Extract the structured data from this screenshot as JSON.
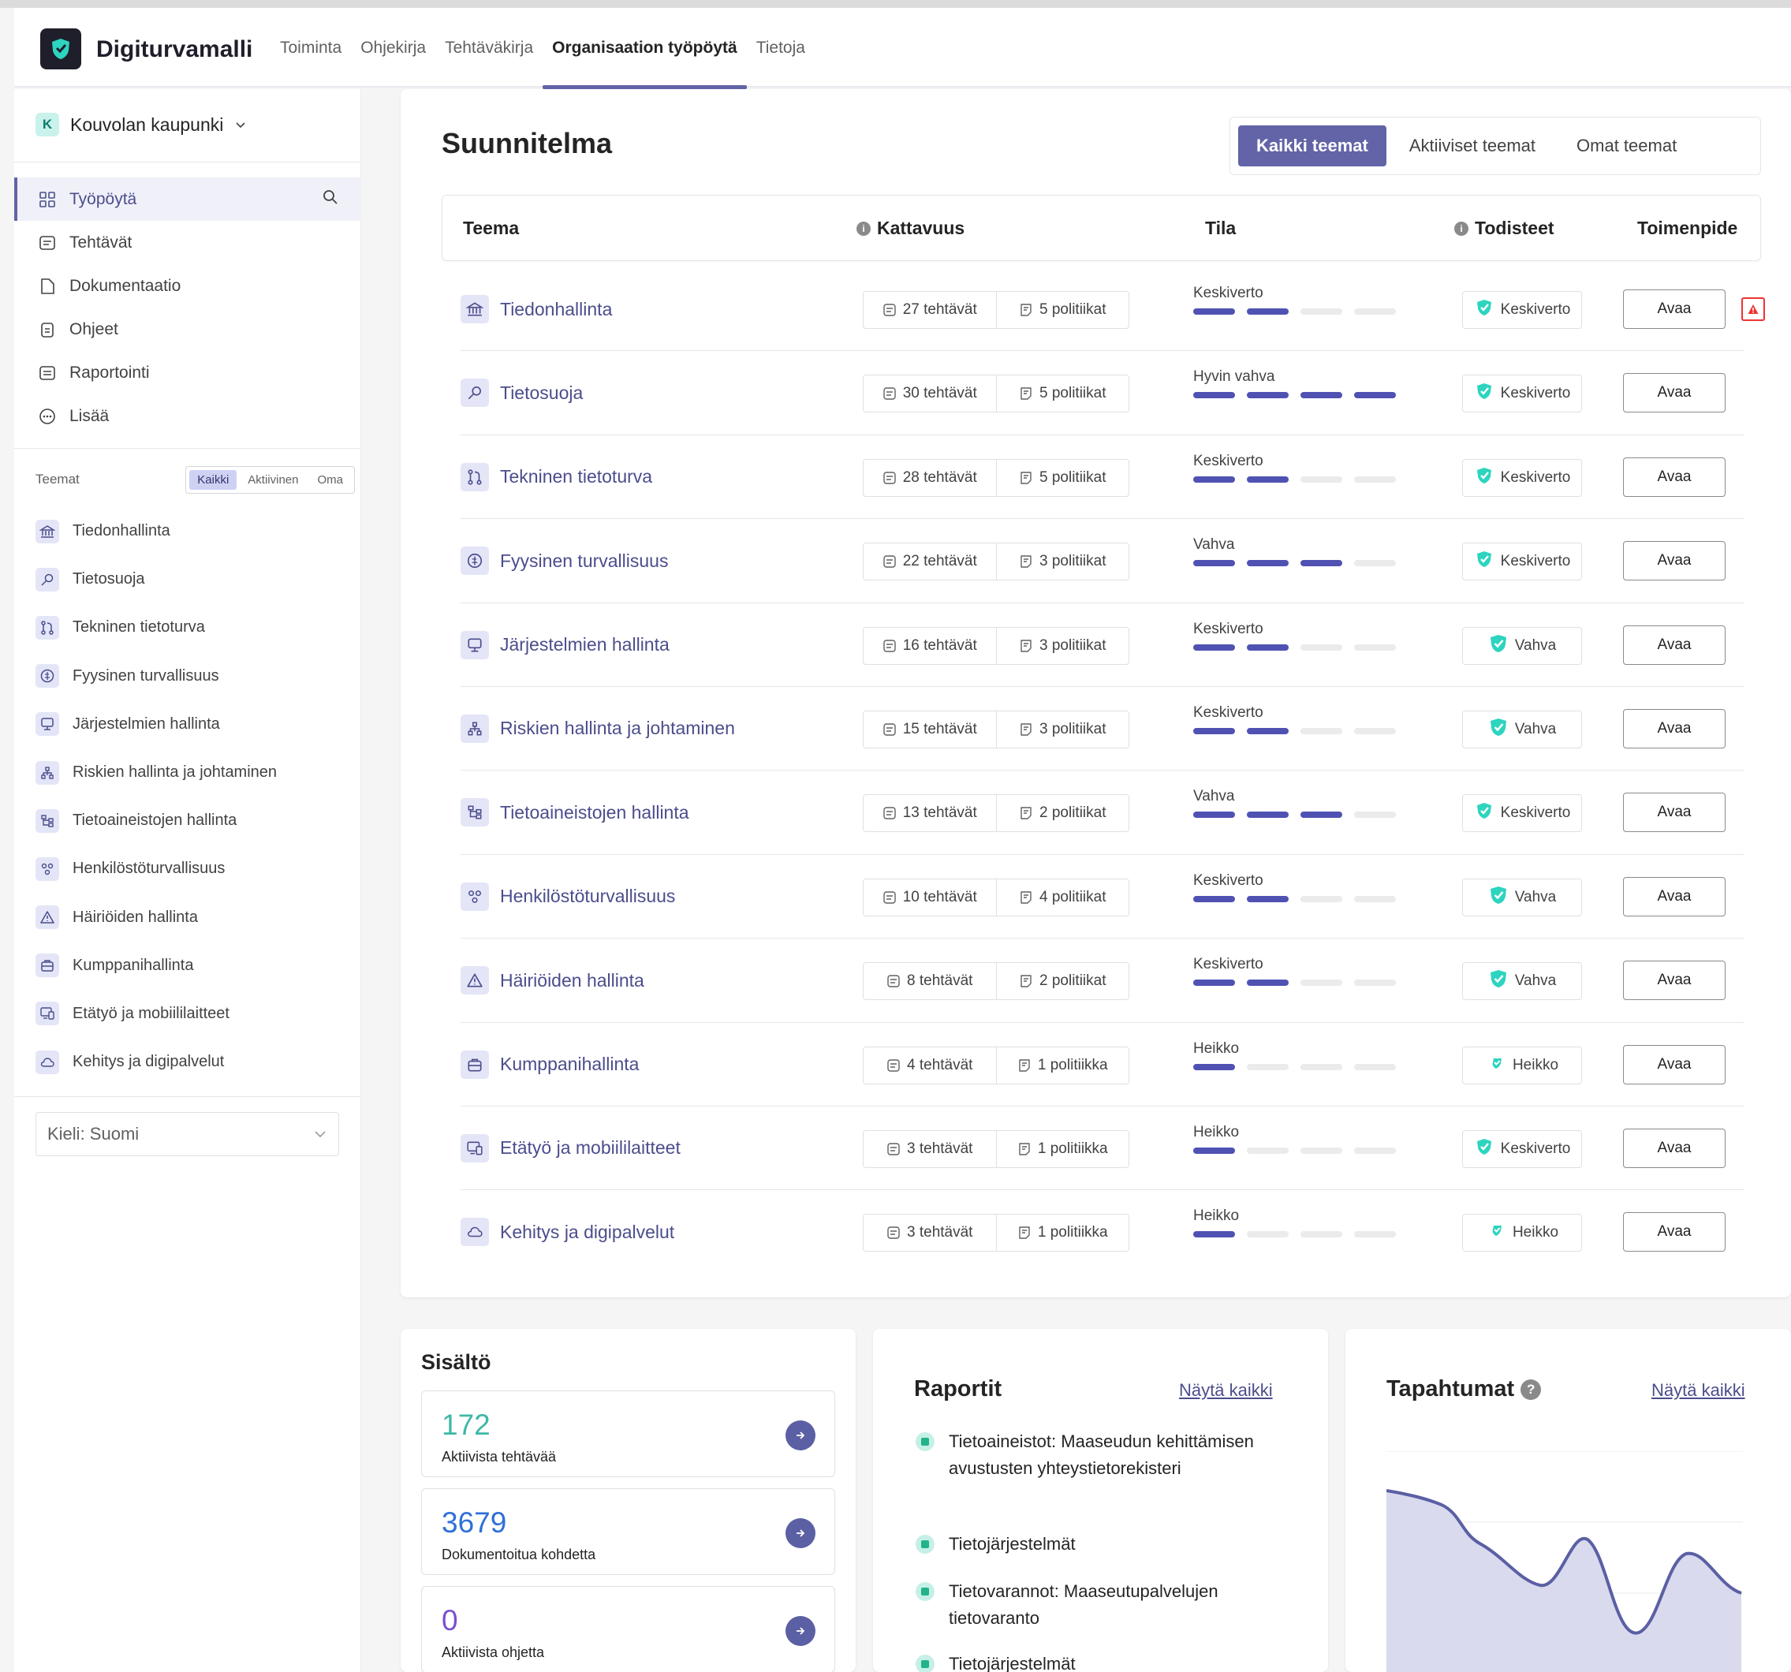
{
  "app": {
    "title": "Digiturvamalli"
  },
  "topnav": [
    {
      "label": "Toiminta",
      "active": false
    },
    {
      "label": "Ohjekirja",
      "active": false
    },
    {
      "label": "Tehtäväkirja",
      "active": false
    },
    {
      "label": "Organisaation työpöytä",
      "active": true
    },
    {
      "label": "Tietoja",
      "active": false
    }
  ],
  "sidebar": {
    "org": {
      "initial": "K",
      "name": "Kouvolan kaupunki"
    },
    "menu": [
      {
        "label": "Työpöytä",
        "icon": "grid-icon"
      },
      {
        "label": "Tehtävät",
        "icon": "tasks-icon"
      },
      {
        "label": "Dokumentaatio",
        "icon": "document-icon"
      },
      {
        "label": "Ohjeet",
        "icon": "clipboard-icon"
      },
      {
        "label": "Raportointi",
        "icon": "report-icon"
      },
      {
        "label": "Lisää",
        "icon": "more-icon"
      }
    ],
    "themes_label": "Teemat",
    "theme_filter": [
      "Kaikki",
      "Aktiivinen",
      "Oma"
    ],
    "themes": [
      "Tiedonhallinta",
      "Tietosuoja",
      "Tekninen tietoturva",
      "Fyysinen turvallisuus",
      "Järjestelmien hallinta",
      "Riskien hallinta ja johtaminen",
      "Tietoaineistojen hallinta",
      "Henkilöstöturvallisuus",
      "Häiriöiden hallinta",
      "Kumppanihallinta",
      "Etätyö ja mobiililaitteet",
      "Kehitys ja digipalvelut"
    ],
    "language": "Kieli: Suomi"
  },
  "plan": {
    "title": "Suunnitelma",
    "filters": [
      "Kaikki teemat",
      "Aktiiviset teemat",
      "Omat teemat"
    ],
    "columns": {
      "theme": "Teema",
      "coverage": "Kattavuus",
      "status": "Tila",
      "evidence": "Todisteet",
      "action": "Toimenpide"
    },
    "rows": [
      {
        "name": "Tiedonhallinta",
        "tasks": "27 tehtävät",
        "policies": "5 politiikat",
        "status": "Keskiverto",
        "level": 2,
        "evidence": "Keskiverto",
        "action": "Avaa",
        "alert": true
      },
      {
        "name": "Tietosuoja",
        "tasks": "30 tehtävät",
        "policies": "5 politiikat",
        "status": "Hyvin vahva",
        "level": 4,
        "evidence": "Keskiverto",
        "action": "Avaa",
        "alert": false
      },
      {
        "name": "Tekninen tietoturva",
        "tasks": "28 tehtävät",
        "policies": "5 politiikat",
        "status": "Keskiverto",
        "level": 2,
        "evidence": "Keskiverto",
        "action": "Avaa",
        "alert": false
      },
      {
        "name": "Fyysinen turvallisuus",
        "tasks": "22 tehtävät",
        "policies": "3 politiikat",
        "status": "Vahva",
        "level": 3,
        "evidence": "Keskiverto",
        "action": "Avaa",
        "alert": false
      },
      {
        "name": "Järjestelmien hallinta",
        "tasks": "16 tehtävät",
        "policies": "3 politiikat",
        "status": "Keskiverto",
        "level": 2,
        "evidence": "Vahva",
        "action": "Avaa",
        "alert": false
      },
      {
        "name": "Riskien hallinta ja johtaminen",
        "tasks": "15 tehtävät",
        "policies": "3 politiikat",
        "status": "Keskiverto",
        "level": 2,
        "evidence": "Vahva",
        "action": "Avaa",
        "alert": false
      },
      {
        "name": "Tietoaineistojen hallinta",
        "tasks": "13 tehtävät",
        "policies": "2 politiikat",
        "status": "Vahva",
        "level": 3,
        "evidence": "Keskiverto",
        "action": "Avaa",
        "alert": false
      },
      {
        "name": "Henkilöstöturvallisuus",
        "tasks": "10 tehtävät",
        "policies": "4 politiikat",
        "status": "Keskiverto",
        "level": 2,
        "evidence": "Vahva",
        "action": "Avaa",
        "alert": false
      },
      {
        "name": "Häiriöiden hallinta",
        "tasks": "8 tehtävät",
        "policies": "2 politiikat",
        "status": "Keskiverto",
        "level": 2,
        "evidence": "Vahva",
        "action": "Avaa",
        "alert": false
      },
      {
        "name": "Kumppanihallinta",
        "tasks": "4 tehtävät",
        "policies": "1 politiikka",
        "status": "Heikko",
        "level": 1,
        "evidence": "Heikko",
        "action": "Avaa",
        "alert": false
      },
      {
        "name": "Etätyö ja mobiililaitteet",
        "tasks": "3 tehtävät",
        "policies": "1 politiikka",
        "status": "Heikko",
        "level": 1,
        "evidence": "Keskiverto",
        "action": "Avaa",
        "alert": false
      },
      {
        "name": "Kehitys ja digipalvelut",
        "tasks": "3 tehtävät",
        "policies": "1 politiikka",
        "status": "Heikko",
        "level": 1,
        "evidence": "Heikko",
        "action": "Avaa",
        "alert": false
      }
    ]
  },
  "content_card": {
    "title": "Sisältö",
    "stats": [
      {
        "value": "172",
        "label": "Aktiivista tehtävää",
        "color": "#3fb8a6"
      },
      {
        "value": "3679",
        "label": "Dokumentoitua kohdetta",
        "color": "#2f6fd8"
      },
      {
        "value": "0",
        "label": "Aktiivista ohjetta",
        "color": "#7a4fd1"
      }
    ]
  },
  "reports_card": {
    "title": "Raportit",
    "show_all": "Näytä kaikki",
    "items": [
      "Tietoaineistot: Maaseudun kehittämisen avustusten yhteystietorekisteri",
      "Tietojärjestelmät",
      "Tietovarannot: Maaseutupalvelujen tietovaranto",
      "Tietojärjestelmät"
    ]
  },
  "events_card": {
    "title": "Tapahtumat",
    "show_all": "Näytä kaikki"
  },
  "colors": {
    "accent": "#6264a7",
    "teal": "#2dd4bf"
  }
}
